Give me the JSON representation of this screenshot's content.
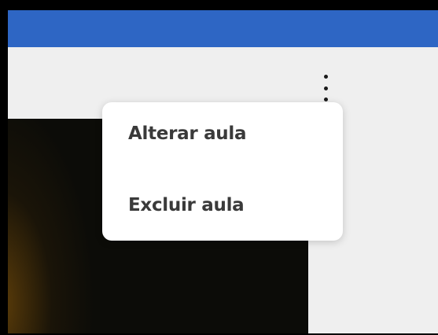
{
  "colors": {
    "top_bar": "#2e66c4",
    "page_background": "#efefef",
    "menu_background": "#ffffff",
    "menu_text": "#3a3a3a"
  },
  "header": {
    "more_options_icon": "vertical-ellipsis-icon"
  },
  "context_menu": {
    "items": [
      {
        "label": "Alterar aula"
      },
      {
        "label": "Excluir aula"
      }
    ]
  }
}
